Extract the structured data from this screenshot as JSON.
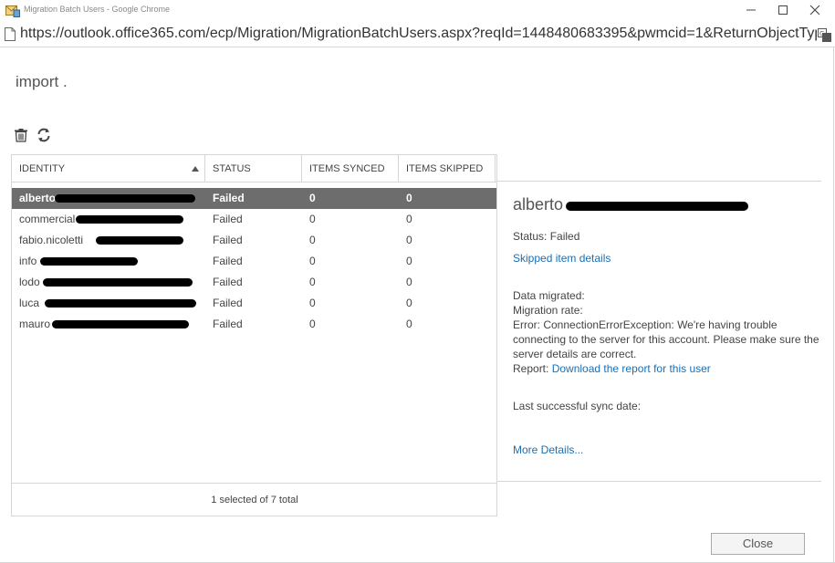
{
  "window": {
    "title": "Migration Batch Users - Google Chrome",
    "url": "https://outlook.office365.com/ecp/Migration/MigrationBatchUsers.aspx?reqId=1448480683395&pwmcid=1&ReturnObjectType=1"
  },
  "page": {
    "title": "import ."
  },
  "toolbar": {
    "delete_icon": "trash-icon",
    "refresh_icon": "refresh-icon"
  },
  "grid": {
    "columns": [
      "IDENTITY",
      "STATUS",
      "ITEMS SYNCED",
      "ITEMS SKIPPED"
    ],
    "rows": [
      {
        "identity": "alberto",
        "status": "Failed",
        "synced": "0",
        "skipped": "0",
        "selected": true
      },
      {
        "identity": "commercial",
        "status": "Failed",
        "synced": "0",
        "skipped": "0",
        "selected": false
      },
      {
        "identity": "fabio.nicoletti",
        "status": "Failed",
        "synced": "0",
        "skipped": "0",
        "selected": false
      },
      {
        "identity": "info",
        "status": "Failed",
        "synced": "0",
        "skipped": "0",
        "selected": false
      },
      {
        "identity": "lodo",
        "status": "Failed",
        "synced": "0",
        "skipped": "0",
        "selected": false
      },
      {
        "identity": "luca",
        "status": "Failed",
        "synced": "0",
        "skipped": "0",
        "selected": false
      },
      {
        "identity": "mauro",
        "status": "Failed",
        "synced": "0",
        "skipped": "0",
        "selected": false
      }
    ],
    "footer": "1 selected of 7 total"
  },
  "details": {
    "name": "alberto",
    "status": "Status: Failed",
    "skipped_link": "Skipped item details",
    "data_migrated": "Data migrated:",
    "migration_rate": "Migration rate:",
    "error": "Error: ConnectionErrorException: We're having trouble connecting to the server for this account. Please make sure the server details are correct.",
    "report_label": "Report:",
    "report_link": "Download the report for this user",
    "last_sync": "Last successful sync date:",
    "more_details": "More Details..."
  },
  "buttons": {
    "close": "Close"
  }
}
